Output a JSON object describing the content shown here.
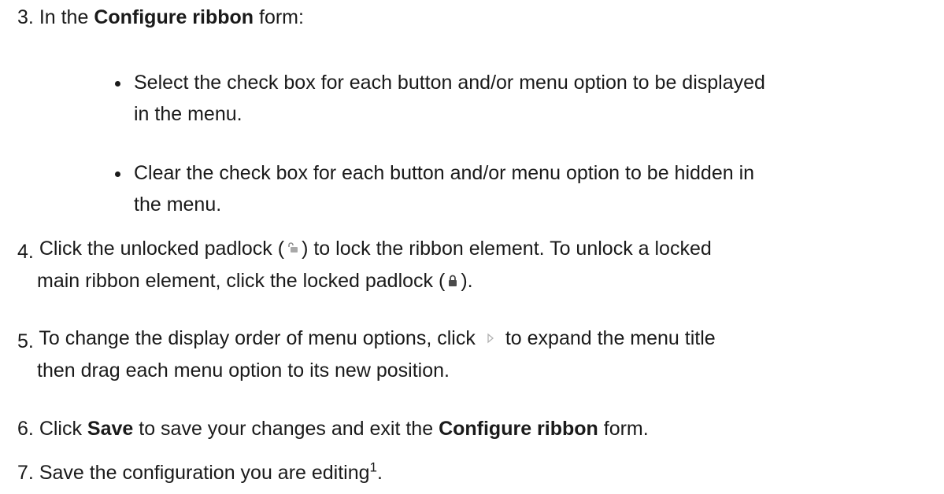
{
  "steps": [
    {
      "number": "3.",
      "before": "In the ",
      "bold": "Configure ribbon",
      "after": " form:"
    },
    {
      "number": "4.",
      "line1_a": "Click the unlocked padlock (",
      "line1_b": ") to lock the ribbon element. To unlock a locked",
      "line2_a": "main ribbon element, click the locked padlock (",
      "line2_b": ")."
    },
    {
      "number": "5.",
      "line1_a": "To change the display order of menu options, click",
      "line1_b": "to expand the menu title",
      "line2": "then drag each menu option to its new position."
    },
    {
      "number": "6.",
      "a": "Click ",
      "bold1": "Save",
      "b": " to save your changes and exit the ",
      "bold2": "Configure ribbon",
      "c": " form."
    },
    {
      "number": "7.",
      "text": "Save the configuration you are editing",
      "sup": "1",
      "end": "."
    }
  ],
  "bullets": [
    {
      "line1": "Select the check box for each button and/or menu option to be displayed",
      "line2": "in the menu."
    },
    {
      "line1": "Clear the check box for each button and/or menu option to be hidden in",
      "line2": "the menu."
    }
  ],
  "icons": {
    "unlocked": "unlocked-padlock-icon",
    "locked": "locked-padlock-icon",
    "expand": "expand-arrow-icon"
  }
}
